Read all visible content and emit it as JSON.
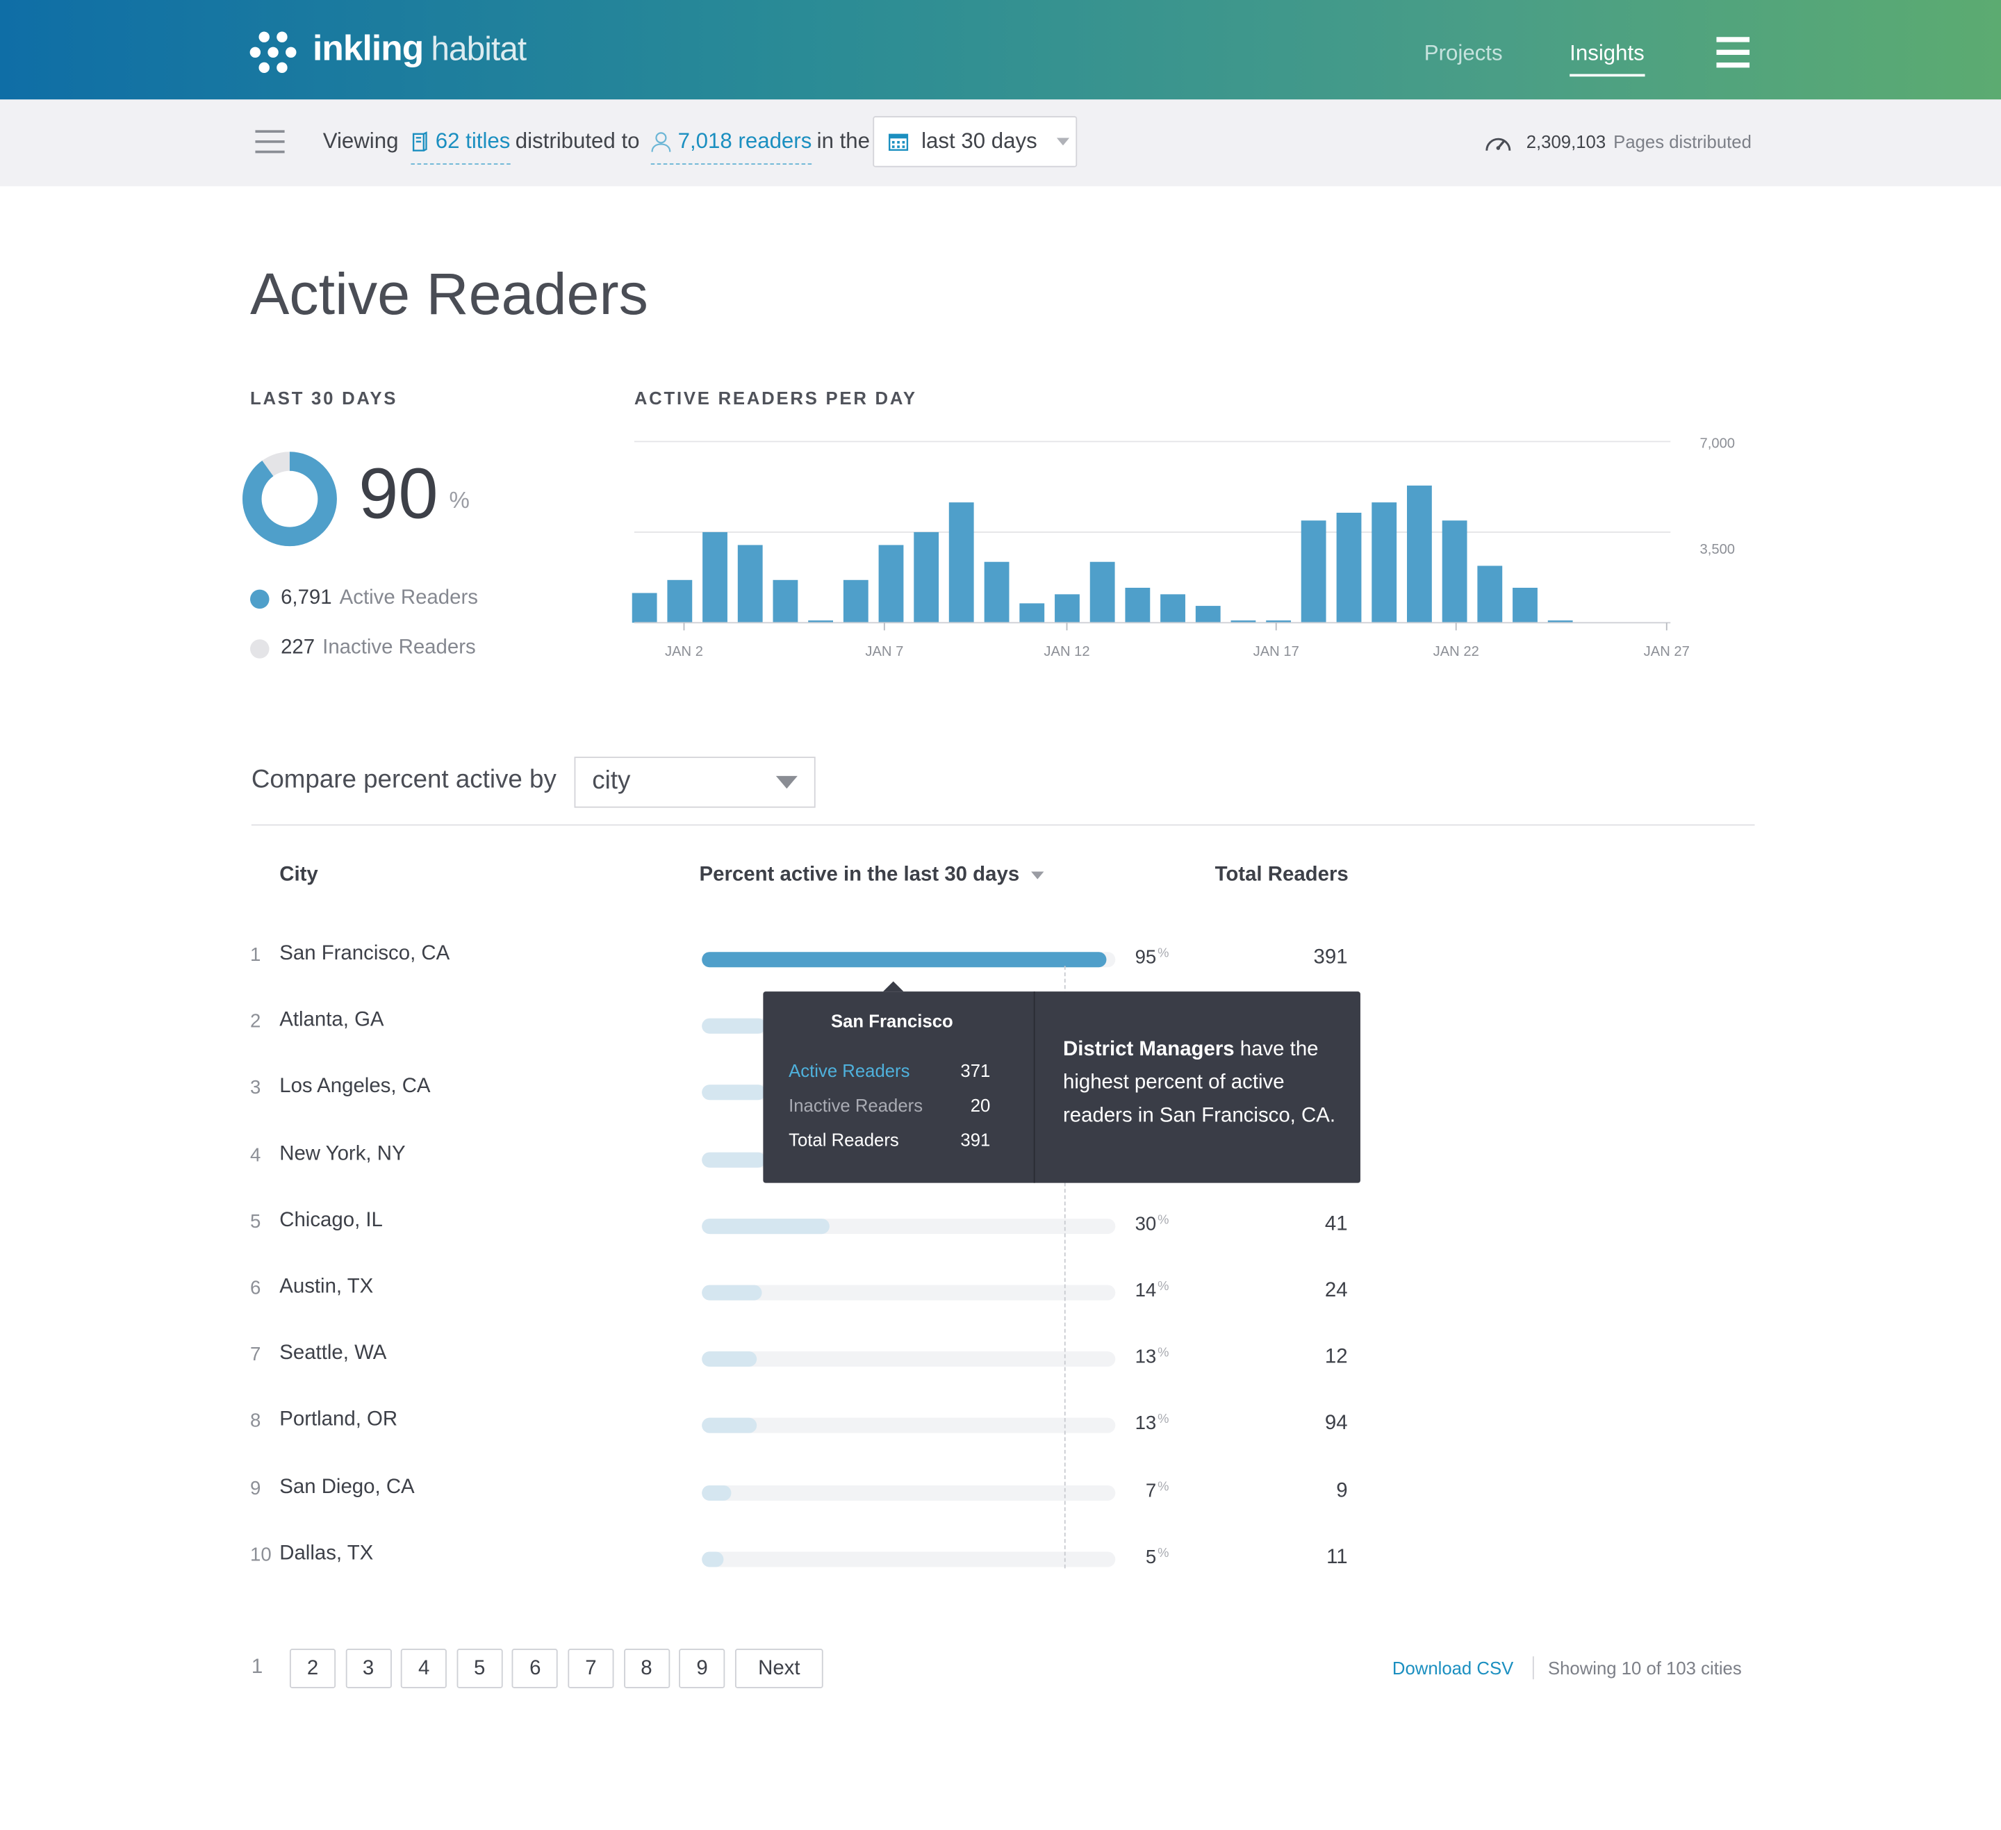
{
  "header": {
    "brand_bold": "inkling",
    "brand_light": "habitat",
    "nav": [
      {
        "label": "Projects"
      },
      {
        "label": "Insights"
      }
    ],
    "menu_icon": "hamburger-menu-icon",
    "gradient_start": "#0f6ea6",
    "gradient_end": "#5cab71"
  },
  "subbar": {
    "viewing_label": "Viewing",
    "titles_link": "62 titles",
    "distributed_to": "distributed to",
    "readers_link": "7,018 readers",
    "in_the": "in the",
    "date_range": "last 30 days",
    "pages_count": "2,309,103",
    "pages_label": "Pages distributed"
  },
  "page": {
    "title": "Active Readers"
  },
  "summary": {
    "section_label": "LAST 30 DAYS",
    "percent": "90",
    "percent_sign": "%",
    "percent_value": 0.9,
    "active_count": "6,791",
    "active_label": "Active Readers",
    "inactive_count": "227",
    "inactive_label": "Inactive Readers",
    "active_color": "#4f9fca",
    "inactive_color": "#e4e4e7"
  },
  "chart_data": {
    "type": "bar",
    "title": "ACTIVE READERS PER DAY",
    "x_tick_labels": [
      "JAN 2",
      "JAN 7",
      "JAN 12",
      "JAN 17",
      "JAN 22",
      "JAN 27"
    ],
    "y_tick_labels": [
      "7,000",
      "3,500"
    ],
    "ylim": [
      0,
      7000
    ],
    "grid": true,
    "color": "#4f9fca",
    "x": [
      "Jan 1",
      "Jan 2",
      "Jan 3",
      "Jan 4",
      "Jan 5",
      "Jan 6",
      "Jan 7",
      "Jan 8",
      "Jan 9",
      "Jan 10",
      "Jan 11",
      "Jan 12",
      "Jan 13",
      "Jan 14",
      "Jan 15",
      "Jan 16",
      "Jan 17",
      "Jan 18",
      "Jan 19",
      "Jan 20",
      "Jan 21",
      "Jan 22",
      "Jan 23",
      "Jan 24",
      "Jan 25",
      "Jan 26",
      "Jan 27",
      "Jan 28"
    ],
    "values": [
      1150,
      1650,
      3500,
      3000,
      1650,
      90,
      1650,
      3000,
      3500,
      4650,
      2350,
      750,
      1100,
      2350,
      1350,
      1100,
      650,
      90,
      90,
      3950,
      4250,
      4650,
      5300,
      3950,
      2200,
      1350,
      90,
      0
    ]
  },
  "compare": {
    "label": "Compare percent active by",
    "selected": "city",
    "col_city": "City",
    "col_percent": "Percent active in the last 30 days",
    "col_total": "Total Readers",
    "pct_unit": "%",
    "rows": [
      {
        "rank": "1",
        "city": "San Francisco, CA",
        "pct": "95",
        "pct_value": 95,
        "total": "391"
      },
      {
        "rank": "2",
        "city": "Atlanta, GA",
        "pct": "",
        "pct_value": 15,
        "total": ""
      },
      {
        "rank": "3",
        "city": "Los Angeles, CA",
        "pct": "",
        "pct_value": 15,
        "total": ""
      },
      {
        "rank": "4",
        "city": "New York, NY",
        "pct": "",
        "pct_value": 15,
        "total": ""
      },
      {
        "rank": "5",
        "city": "Chicago, IL",
        "pct": "30",
        "pct_value": 30,
        "total": "41"
      },
      {
        "rank": "6",
        "city": "Austin, TX",
        "pct": "14",
        "pct_value": 14,
        "total": "24"
      },
      {
        "rank": "7",
        "city": "Seattle, WA",
        "pct": "13",
        "pct_value": 13,
        "total": "12"
      },
      {
        "rank": "8",
        "city": "Portland, OR",
        "pct": "13",
        "pct_value": 13,
        "total": "94"
      },
      {
        "rank": "9",
        "city": "San Diego, CA",
        "pct": "7",
        "pct_value": 7,
        "total": "9"
      },
      {
        "rank": "10",
        "city": "Dallas, TX",
        "pct": "5",
        "pct_value": 5,
        "total": "11"
      }
    ]
  },
  "tooltip": {
    "title": "San Francisco",
    "active_label": "Active Readers",
    "active_value": "371",
    "inactive_label": "Inactive Readers",
    "inactive_value": "20",
    "total_label": "Total Readers",
    "total_value": "391",
    "insight_bold": "District Managers",
    "insight_rest": " have the highest percent of active readers in San Francisco, CA."
  },
  "pagination": {
    "current": "1",
    "pages": [
      "2",
      "3",
      "4",
      "5",
      "6",
      "7",
      "8",
      "9"
    ],
    "next": "Next",
    "download": "Download CSV",
    "showing": "Showing 10 of 103 cities"
  }
}
